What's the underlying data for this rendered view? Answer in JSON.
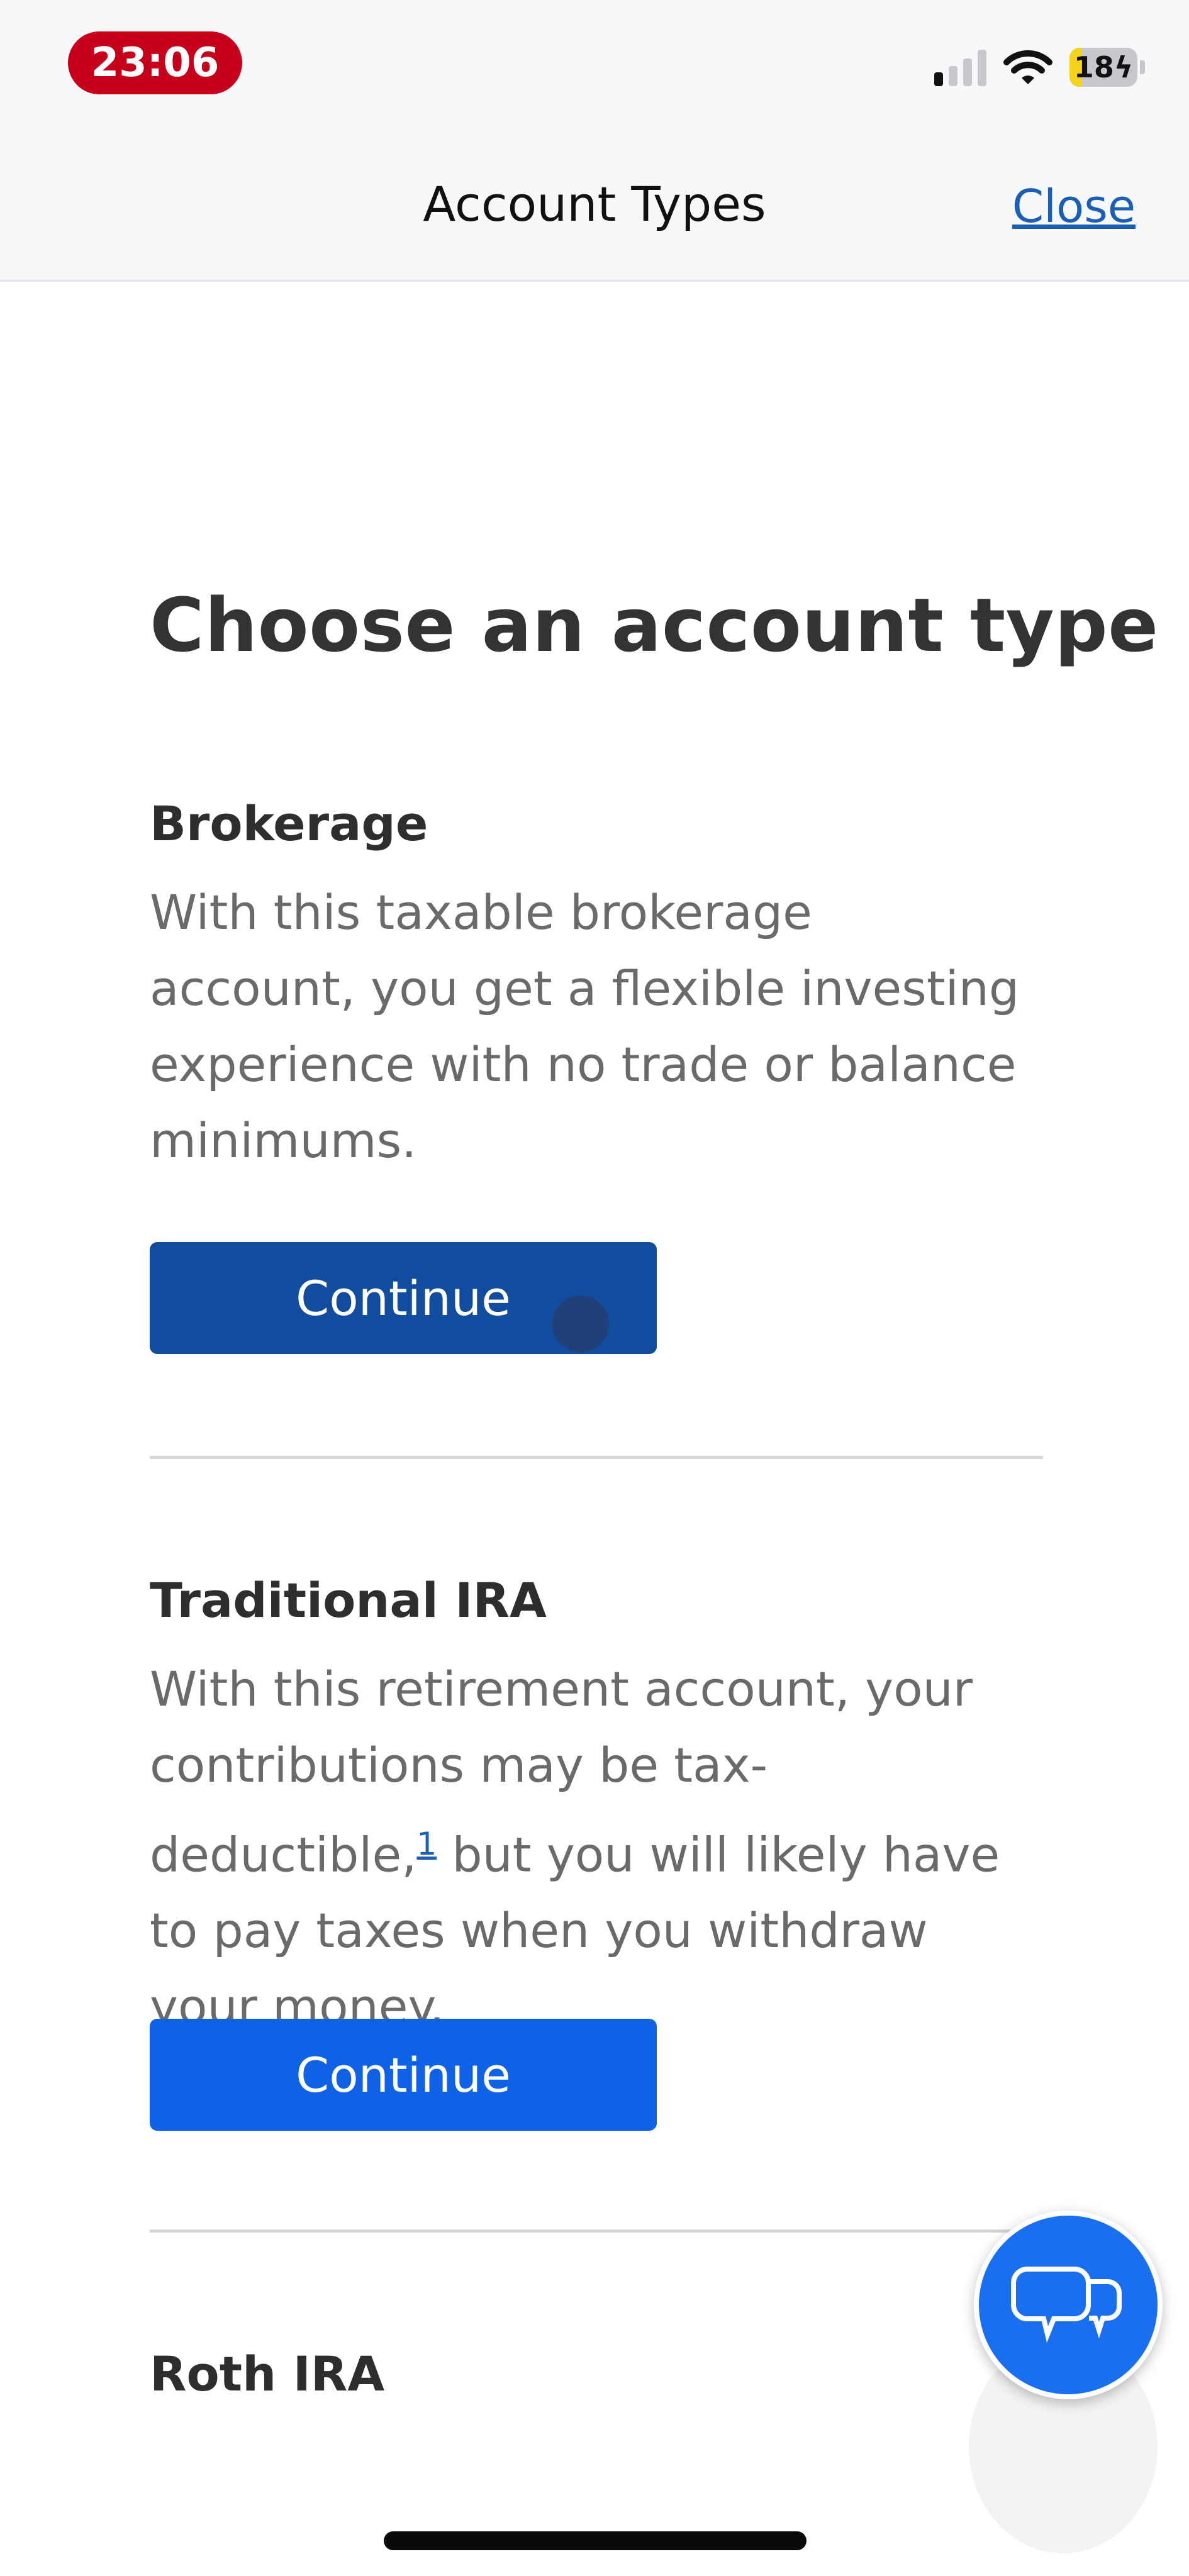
{
  "status_bar": {
    "time": "23:06",
    "signal_bars_active": 1,
    "signal_bars_total": 4,
    "wifi_icon": "wifi-icon",
    "battery_level": "18",
    "battery_fraction": 0.18,
    "battery_charging": true
  },
  "nav": {
    "title": "Account Types",
    "close_label": "Close"
  },
  "page": {
    "title": "Choose an account type"
  },
  "sections": [
    {
      "heading": "Brokerage",
      "description": "With this taxable brokerage account, you get a flexible investing experience with no trade or balance minimums.",
      "button_label": "Continue",
      "button_state": "pressed"
    },
    {
      "heading": "Traditional IRA",
      "description_before": "With this retirement account, your contributions may be tax-deductible,",
      "footnote": "1",
      "description_after": " but you will likely have to pay taxes when you withdraw your money.",
      "button_label": "Continue"
    },
    {
      "heading": "Roth IRA"
    }
  ],
  "chat": {
    "icon": "chat-bubbles-icon"
  },
  "colors": {
    "primary_button": "#0f62e6",
    "pressed_button": "#124c9e",
    "link": "#1a5fb4",
    "time_pill": "#c6001a"
  }
}
